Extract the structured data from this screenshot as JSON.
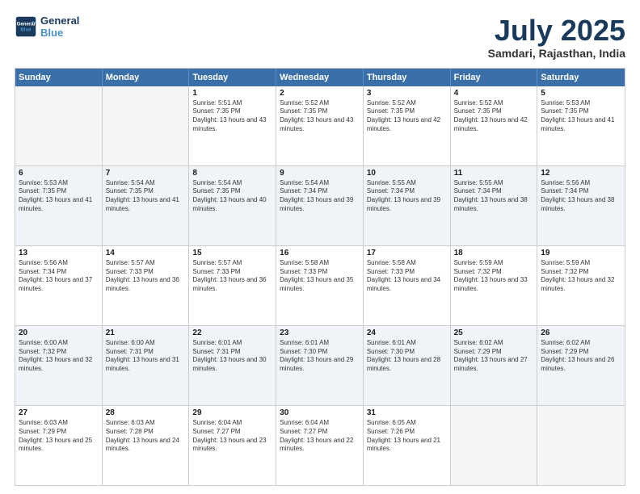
{
  "logo": {
    "line1": "General",
    "line2": "Blue"
  },
  "title": "July 2025",
  "location": "Samdari, Rajasthan, India",
  "header_days": [
    "Sunday",
    "Monday",
    "Tuesday",
    "Wednesday",
    "Thursday",
    "Friday",
    "Saturday"
  ],
  "rows": [
    [
      {
        "day": "",
        "info": ""
      },
      {
        "day": "",
        "info": ""
      },
      {
        "day": "1",
        "info": "Sunrise: 5:51 AM\nSunset: 7:35 PM\nDaylight: 13 hours and 43 minutes."
      },
      {
        "day": "2",
        "info": "Sunrise: 5:52 AM\nSunset: 7:35 PM\nDaylight: 13 hours and 43 minutes."
      },
      {
        "day": "3",
        "info": "Sunrise: 5:52 AM\nSunset: 7:35 PM\nDaylight: 13 hours and 42 minutes."
      },
      {
        "day": "4",
        "info": "Sunrise: 5:52 AM\nSunset: 7:35 PM\nDaylight: 13 hours and 42 minutes."
      },
      {
        "day": "5",
        "info": "Sunrise: 5:53 AM\nSunset: 7:35 PM\nDaylight: 13 hours and 41 minutes."
      }
    ],
    [
      {
        "day": "6",
        "info": "Sunrise: 5:53 AM\nSunset: 7:35 PM\nDaylight: 13 hours and 41 minutes."
      },
      {
        "day": "7",
        "info": "Sunrise: 5:54 AM\nSunset: 7:35 PM\nDaylight: 13 hours and 41 minutes."
      },
      {
        "day": "8",
        "info": "Sunrise: 5:54 AM\nSunset: 7:35 PM\nDaylight: 13 hours and 40 minutes."
      },
      {
        "day": "9",
        "info": "Sunrise: 5:54 AM\nSunset: 7:34 PM\nDaylight: 13 hours and 39 minutes."
      },
      {
        "day": "10",
        "info": "Sunrise: 5:55 AM\nSunset: 7:34 PM\nDaylight: 13 hours and 39 minutes."
      },
      {
        "day": "11",
        "info": "Sunrise: 5:55 AM\nSunset: 7:34 PM\nDaylight: 13 hours and 38 minutes."
      },
      {
        "day": "12",
        "info": "Sunrise: 5:56 AM\nSunset: 7:34 PM\nDaylight: 13 hours and 38 minutes."
      }
    ],
    [
      {
        "day": "13",
        "info": "Sunrise: 5:56 AM\nSunset: 7:34 PM\nDaylight: 13 hours and 37 minutes."
      },
      {
        "day": "14",
        "info": "Sunrise: 5:57 AM\nSunset: 7:33 PM\nDaylight: 13 hours and 36 minutes."
      },
      {
        "day": "15",
        "info": "Sunrise: 5:57 AM\nSunset: 7:33 PM\nDaylight: 13 hours and 36 minutes."
      },
      {
        "day": "16",
        "info": "Sunrise: 5:58 AM\nSunset: 7:33 PM\nDaylight: 13 hours and 35 minutes."
      },
      {
        "day": "17",
        "info": "Sunrise: 5:58 AM\nSunset: 7:33 PM\nDaylight: 13 hours and 34 minutes."
      },
      {
        "day": "18",
        "info": "Sunrise: 5:59 AM\nSunset: 7:32 PM\nDaylight: 13 hours and 33 minutes."
      },
      {
        "day": "19",
        "info": "Sunrise: 5:59 AM\nSunset: 7:32 PM\nDaylight: 13 hours and 32 minutes."
      }
    ],
    [
      {
        "day": "20",
        "info": "Sunrise: 6:00 AM\nSunset: 7:32 PM\nDaylight: 13 hours and 32 minutes."
      },
      {
        "day": "21",
        "info": "Sunrise: 6:00 AM\nSunset: 7:31 PM\nDaylight: 13 hours and 31 minutes."
      },
      {
        "day": "22",
        "info": "Sunrise: 6:01 AM\nSunset: 7:31 PM\nDaylight: 13 hours and 30 minutes."
      },
      {
        "day": "23",
        "info": "Sunrise: 6:01 AM\nSunset: 7:30 PM\nDaylight: 13 hours and 29 minutes."
      },
      {
        "day": "24",
        "info": "Sunrise: 6:01 AM\nSunset: 7:30 PM\nDaylight: 13 hours and 28 minutes."
      },
      {
        "day": "25",
        "info": "Sunrise: 6:02 AM\nSunset: 7:29 PM\nDaylight: 13 hours and 27 minutes."
      },
      {
        "day": "26",
        "info": "Sunrise: 6:02 AM\nSunset: 7:29 PM\nDaylight: 13 hours and 26 minutes."
      }
    ],
    [
      {
        "day": "27",
        "info": "Sunrise: 6:03 AM\nSunset: 7:29 PM\nDaylight: 13 hours and 25 minutes."
      },
      {
        "day": "28",
        "info": "Sunrise: 6:03 AM\nSunset: 7:28 PM\nDaylight: 13 hours and 24 minutes."
      },
      {
        "day": "29",
        "info": "Sunrise: 6:04 AM\nSunset: 7:27 PM\nDaylight: 13 hours and 23 minutes."
      },
      {
        "day": "30",
        "info": "Sunrise: 6:04 AM\nSunset: 7:27 PM\nDaylight: 13 hours and 22 minutes."
      },
      {
        "day": "31",
        "info": "Sunrise: 6:05 AM\nSunset: 7:26 PM\nDaylight: 13 hours and 21 minutes."
      },
      {
        "day": "",
        "info": ""
      },
      {
        "day": "",
        "info": ""
      }
    ]
  ]
}
